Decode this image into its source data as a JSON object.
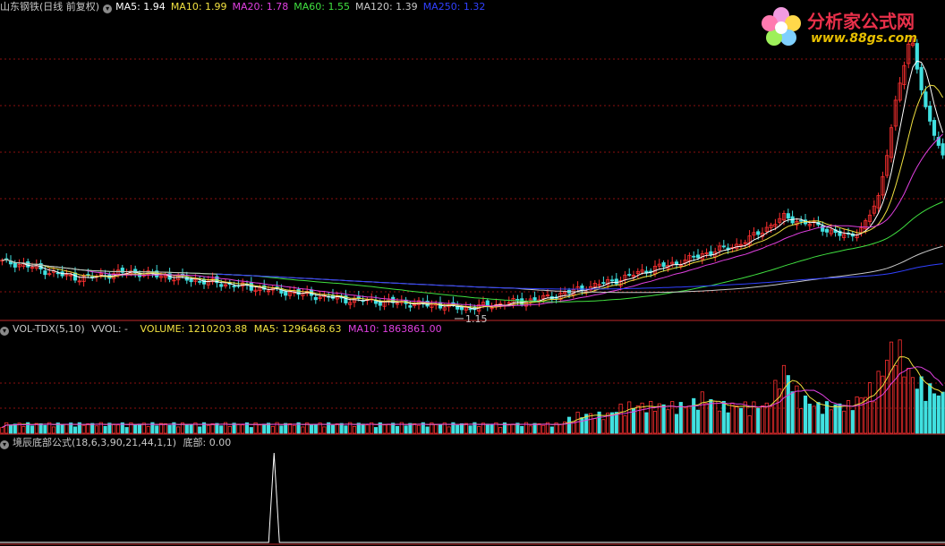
{
  "price_panel": {
    "stock_name": "山东钢铁(日线 前复权)",
    "indicators": [
      {
        "label": "MA5: 1.94",
        "color": "#ffffff"
      },
      {
        "label": "MA10: 1.99",
        "color": "#f0e040"
      },
      {
        "label": "MA20: 1.78",
        "color": "#e040e0"
      },
      {
        "label": "MA60: 1.55",
        "color": "#40e040"
      },
      {
        "label": "MA120: 1.39",
        "color": "#c8c8c8"
      },
      {
        "label": "MA250: 1.32",
        "color": "#3040ff"
      }
    ],
    "low_annotation": "1.15"
  },
  "volume_panel": {
    "indicator_name": "VOL-TDX(5,10)",
    "vvol_label": "VVOL: -",
    "volume_label": "VOLUME: 1210203.88",
    "ma5_label": "MA5: 1296468.63",
    "ma10_label": "MA10: 1863861.00",
    "colors": {
      "volume": "#f0e040",
      "ma5": "#f0e040",
      "ma10": "#e040e0"
    }
  },
  "bottom_panel": {
    "formula_name": "境辰底部公式(18,6,3,90,21,44,1,1)",
    "value_label": "底部: 0.00"
  },
  "logo": {
    "name": "分析家公式网",
    "url": "www.88gs.com"
  },
  "colors": {
    "up": "#ff3030",
    "down": "#40e0e0",
    "grid": "#8b1010",
    "divider": "#c0282a"
  },
  "chart_data": {
    "type": "candlestick",
    "symbol": "山东钢铁",
    "period": "日线 前复权",
    "price_range_visible": [
      1.1,
      2.6
    ],
    "close_approx": [
      1.38,
      1.37,
      1.35,
      1.33,
      1.31,
      1.3,
      1.31,
      1.32,
      1.33,
      1.32,
      1.31,
      1.3,
      1.29,
      1.28,
      1.27,
      1.26,
      1.25,
      1.24,
      1.23,
      1.22,
      1.21,
      1.2,
      1.19,
      1.19,
      1.18,
      1.18,
      1.17,
      1.17,
      1.16,
      1.15,
      1.16,
      1.17,
      1.18,
      1.19,
      1.2,
      1.22,
      1.24,
      1.26,
      1.28,
      1.3,
      1.33,
      1.35,
      1.37,
      1.39,
      1.42,
      1.44,
      1.46,
      1.5,
      1.55,
      1.6,
      1.58,
      1.56,
      1.53,
      1.5,
      1.55,
      1.7,
      2.15,
      2.5,
      2.1,
      1.9
    ],
    "volume_relative": [
      0.1,
      0.1,
      0.1,
      0.1,
      0.1,
      0.1,
      0.1,
      0.1,
      0.1,
      0.1,
      0.1,
      0.1,
      0.1,
      0.1,
      0.1,
      0.1,
      0.1,
      0.1,
      0.1,
      0.1,
      0.1,
      0.1,
      0.1,
      0.1,
      0.1,
      0.1,
      0.1,
      0.1,
      0.1,
      0.1,
      0.1,
      0.1,
      0.1,
      0.1,
      0.1,
      0.1,
      0.2,
      0.2,
      0.2,
      0.3,
      0.3,
      0.3,
      0.3,
      0.3,
      0.4,
      0.3,
      0.3,
      0.3,
      0.3,
      0.7,
      0.4,
      0.3,
      0.3,
      0.3,
      0.4,
      0.6,
      1.0,
      0.6,
      0.5,
      0.4
    ],
    "bottom_signal_peak_position": 0.29
  }
}
